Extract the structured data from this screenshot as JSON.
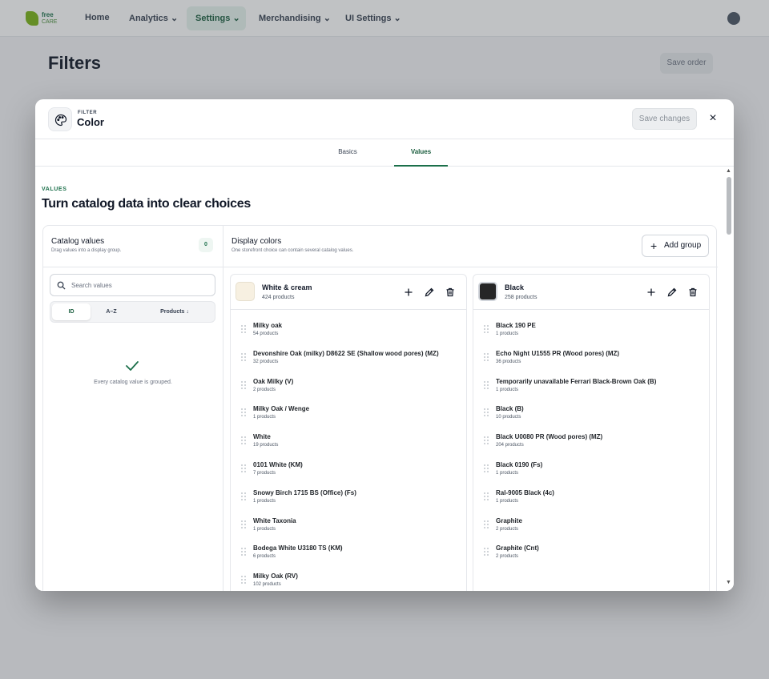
{
  "background": {
    "logo_text_1": "free",
    "logo_text_2": "CARE",
    "nav": [
      "Home",
      "Analytics",
      "Settings",
      "Merchandising",
      "UI Settings"
    ],
    "page_title": "Filters",
    "page_button": "Save order"
  },
  "modal": {
    "eyebrow": "FILTER",
    "title": "Color",
    "save_label": "Save changes",
    "close_label": "×",
    "tabs": [
      {
        "label": "Basics"
      },
      {
        "label": "Values"
      }
    ],
    "values": {
      "eyebrow": "VALUES",
      "heading": "Turn catalog data into clear choices"
    },
    "catalog": {
      "title": "Catalog values",
      "subtitle": "Drag values into a display group.",
      "count": "0",
      "search_placeholder": "Search values",
      "sort": [
        "ID",
        "A–Z",
        "Products ↓"
      ],
      "empty_message": "Every catalog value is grouped."
    },
    "display": {
      "title": "Display colors",
      "subtitle": "One storefront choice can contain several catalog values.",
      "add_group_label": "Add group"
    },
    "groups": [
      {
        "name": "White & cream",
        "count": "424 products",
        "swatch": "#f7f0e1",
        "items": [
          {
            "name": "Milky oak",
            "count": "54 products"
          },
          {
            "name": "Devonshire Oak (milky) D8622 SE (Shallow wood pores) (MZ)",
            "count": "32 products"
          },
          {
            "name": "Oak Milky (V)",
            "count": "2 products"
          },
          {
            "name": "Milky Oak / Wenge",
            "count": "1 products"
          },
          {
            "name": "White",
            "count": "19 products"
          },
          {
            "name": "0101 White (KM)",
            "count": "7 products"
          },
          {
            "name": "Snowy Birch 1715 BS (Office) (Fs)",
            "count": "1 products"
          },
          {
            "name": "White Taxonia",
            "count": "1 products"
          },
          {
            "name": "Bodega White U3180 TS (KM)",
            "count": "6 products"
          },
          {
            "name": "Milky Oak (RV)",
            "count": "102 products"
          }
        ]
      },
      {
        "name": "Black",
        "count": "258 products",
        "swatch": "#262626",
        "items": [
          {
            "name": "Black 190 PE",
            "count": "1 products"
          },
          {
            "name": "Echo Night U1555 PR (Wood pores) (MZ)",
            "count": "36 products"
          },
          {
            "name": "Temporarily unavailable Ferrari Black-Brown Oak (B)",
            "count": "1 products"
          },
          {
            "name": "Black (B)",
            "count": "10 products"
          },
          {
            "name": "Black U0080 PR (Wood pores) (MZ)",
            "count": "204 products"
          },
          {
            "name": "Black 0190 (Fs)",
            "count": "1 products"
          },
          {
            "name": "Ral-9005 Black (4c)",
            "count": "1 products"
          },
          {
            "name": "Graphite",
            "count": "2 products"
          },
          {
            "name": "Graphite (Cnt)",
            "count": "2 products"
          }
        ]
      }
    ]
  },
  "colors": {
    "accent": "#1b6f4a",
    "accent_light": "#e6f3ee"
  }
}
